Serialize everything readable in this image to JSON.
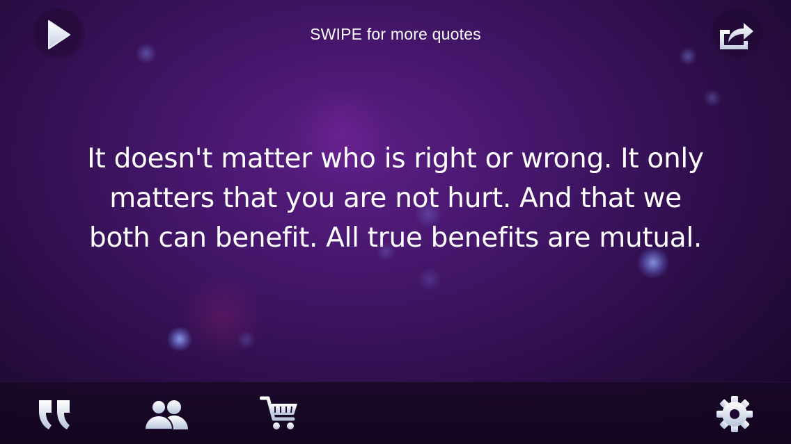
{
  "header": {
    "hint": "SWIPE for more quotes",
    "play_icon": "play-icon",
    "share_icon": "share-icon"
  },
  "quote": {
    "text": "It doesn't matter who is right or wrong. It only matters that you are not hurt. And that we both can benefit. All true benefits are mutual."
  },
  "toolbar": {
    "items": [
      {
        "icon": "quotes-icon"
      },
      {
        "icon": "people-icon"
      },
      {
        "icon": "cart-icon"
      },
      {
        "icon": "gear-icon"
      }
    ]
  },
  "colors": {
    "background": "#44166a",
    "text": "#ffffff",
    "icon": "#dfe6f2",
    "toolbar": "#190828"
  }
}
